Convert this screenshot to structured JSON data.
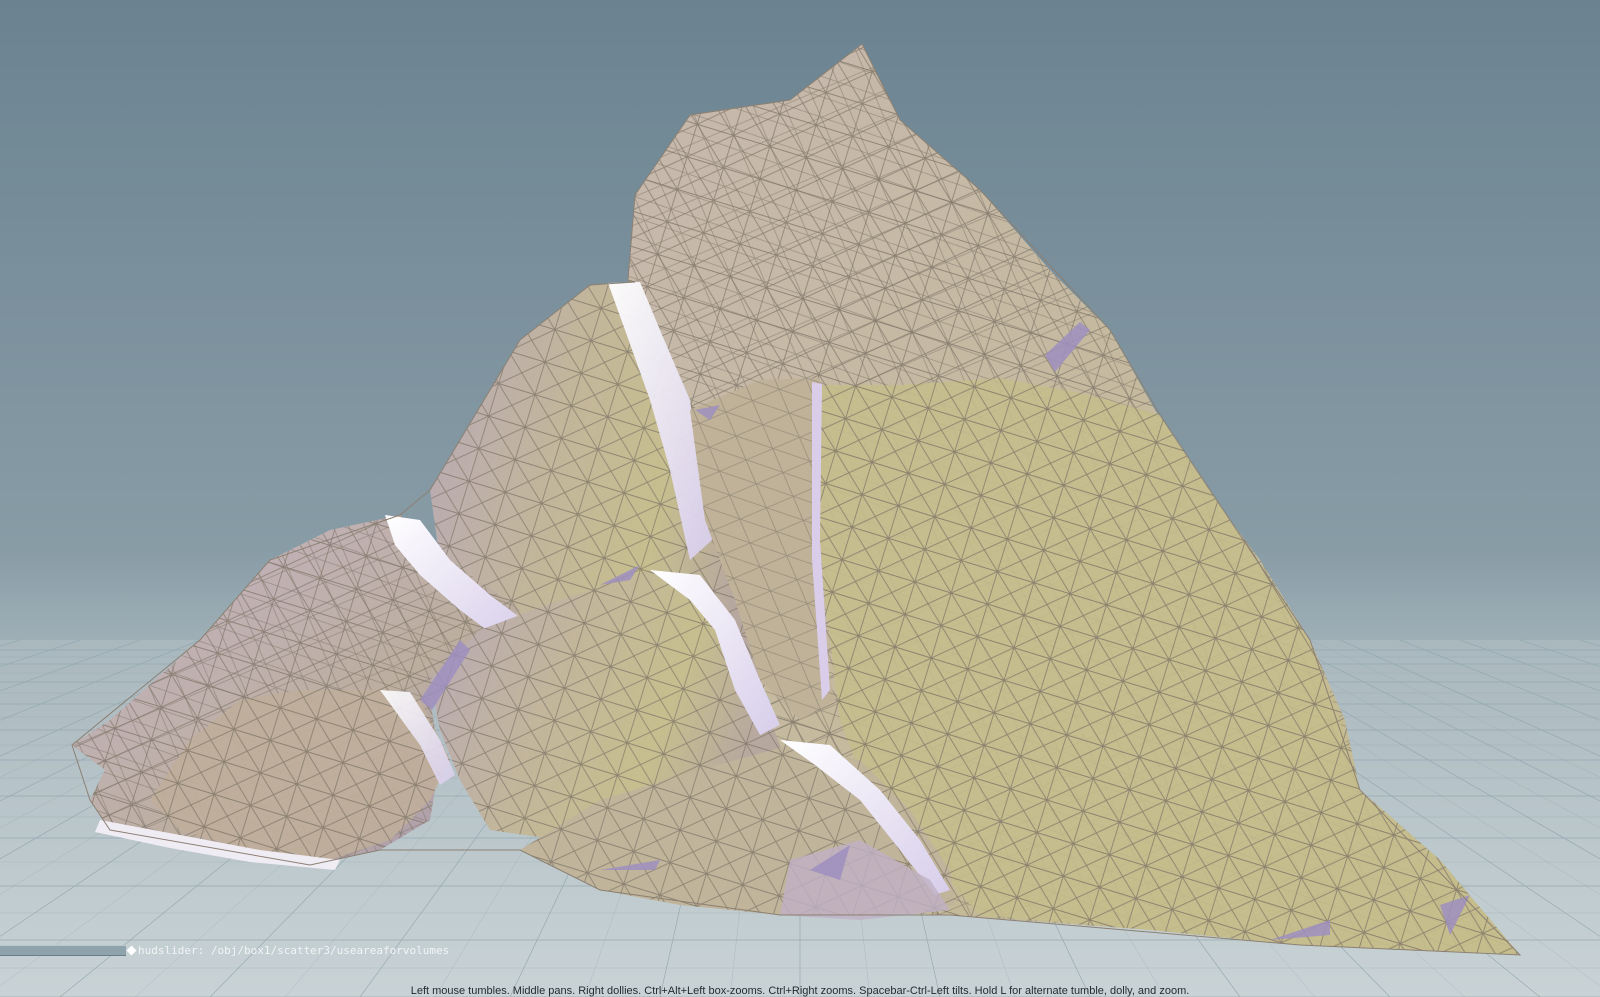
{
  "viewport": {
    "background_top": "#6c8493",
    "background_horizon": "#a6b6bd",
    "grid_color": "#9fb2ba",
    "mesh_light": "#c9bf8f",
    "mesh_shadow": "#b5a6c4",
    "mesh_highlight": "#f1ecf6",
    "wire_color": "#7f776a"
  },
  "hud": {
    "slider_path": "hudslider: /obj/box1/scatter3/useareaforvolumes"
  },
  "status": {
    "hint": "Left mouse tumbles. Middle pans. Right dollies. Ctrl+Alt+Left box-zooms. Ctrl+Right zooms. Spacebar-Ctrl-Left tilts. Hold L for alternate tumble, dolly, and zoom."
  }
}
